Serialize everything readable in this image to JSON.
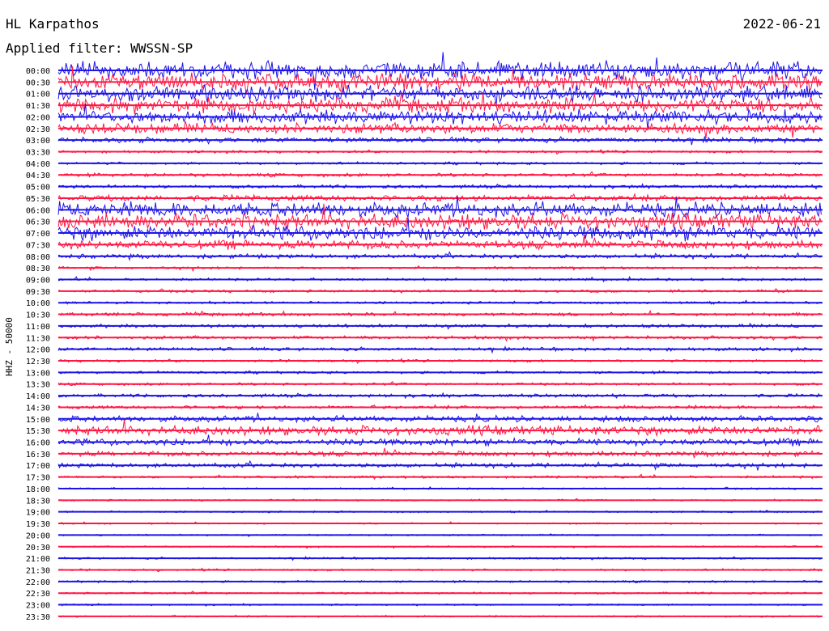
{
  "header": {
    "station": "HL Karpathos",
    "date": "2022-06-21",
    "filter": "Applied filter: WWSSN-SP"
  },
  "side_label": "HHZ - 50000",
  "colors": {
    "blue": "#1e14e6",
    "red": "#ff1744"
  },
  "chart_data": {
    "type": "line",
    "title": "HL Karpathos",
    "subtitle": "Applied filter: WWSSN-SP",
    "ylabel": "HHZ - 50000",
    "row_labels": [
      "00:00",
      "00:30",
      "01:00",
      "01:30",
      "02:00",
      "02:30",
      "03:00",
      "03:30",
      "04:00",
      "04:30",
      "05:00",
      "05:30",
      "06:00",
      "06:30",
      "07:00",
      "07:30",
      "08:00",
      "08:30",
      "09:00",
      "09:30",
      "10:00",
      "10:30",
      "11:00",
      "11:30",
      "12:00",
      "12:30",
      "13:00",
      "13:30",
      "14:00",
      "14:30",
      "15:00",
      "15:30",
      "16:00",
      "16:30",
      "17:00",
      "17:30",
      "18:00",
      "18:30",
      "19:00",
      "19:30",
      "20:00",
      "20:30",
      "21:00",
      "21:30",
      "22:00",
      "22:30",
      "23:00",
      "23:30"
    ],
    "row_colors": [
      "blue",
      "red",
      "blue",
      "red",
      "blue",
      "red",
      "blue",
      "red",
      "blue",
      "red",
      "blue",
      "red",
      "blue",
      "red",
      "blue",
      "red",
      "blue",
      "red",
      "blue",
      "red",
      "blue",
      "red",
      "blue",
      "red",
      "blue",
      "red",
      "blue",
      "red",
      "blue",
      "red",
      "blue",
      "red",
      "blue",
      "red",
      "blue",
      "red",
      "blue",
      "red",
      "blue",
      "red",
      "blue",
      "red",
      "blue",
      "red",
      "blue",
      "red",
      "blue",
      "red"
    ],
    "noise_level": [
      1.0,
      0.95,
      0.9,
      0.85,
      0.8,
      0.6,
      0.3,
      0.15,
      0.15,
      0.2,
      0.2,
      0.35,
      0.85,
      0.9,
      0.85,
      0.5,
      0.25,
      0.15,
      0.15,
      0.15,
      0.15,
      0.2,
      0.2,
      0.2,
      0.2,
      0.15,
      0.15,
      0.15,
      0.2,
      0.2,
      0.35,
      0.55,
      0.4,
      0.3,
      0.25,
      0.15,
      0.1,
      0.1,
      0.1,
      0.1,
      0.1,
      0.1,
      0.12,
      0.12,
      0.12,
      0.12,
      0.1,
      0.1
    ]
  }
}
